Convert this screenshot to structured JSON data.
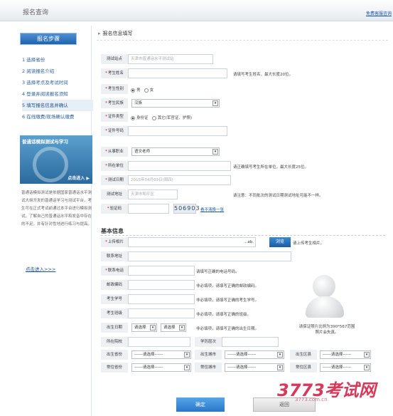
{
  "header": {
    "title": "报名查询",
    "link": "免费客服咨询"
  },
  "sidebar": {
    "steps_title": "报名步骤",
    "steps": [
      "1 选择省份",
      "2 阅读报名介绍",
      "3 选择考点及考试时间",
      "4 登录并阅读报名须知",
      "5 填写报名信息并确认",
      "6 在线缴费/现场确认缴费"
    ],
    "promo_title": "普通话模拟测试与学习",
    "promo_enter": "点击进入 ▶",
    "description": "普通话模拟测试是依据国家普通话水平测试大纲开发的普通话学习与测试平台，考生可在正式考试前通过本平台进行模拟测试，了解自己的普通话水平和发音中存在的不足，并有针对性地进行练习与提高。",
    "desc_link": "点击进入>>>"
  },
  "form": {
    "section_title": "报名信息填写",
    "fields": {
      "test_site": {
        "label": "测试站点",
        "value": "天津市普通话水平测试站"
      },
      "name": {
        "label": "考生姓名",
        "hint": "请填写考生姓名，最大长度20位。"
      },
      "gender": {
        "label": "考生性别",
        "opt1": "男",
        "opt2": "女"
      },
      "ethnicity": {
        "label": "考生民族",
        "value": "汉族"
      },
      "id_type": {
        "label": "证件类型",
        "opt1": "身份证",
        "opt2": "其它(军官证、护照)"
      },
      "id_number": {
        "label": "证件号码"
      },
      "occupation": {
        "label": "从事职业",
        "value": "语文老师"
      },
      "workplace": {
        "label": "所在单位",
        "hint": "请正确填写考生所在单位，最大长度25位。"
      },
      "test_date": {
        "label": "测试日期",
        "value": "2015年04月09日(周四)"
      },
      "test_address": {
        "label": "测试地址",
        "value": "天津市和平区",
        "hint": "请注意：不同批次的测试日期测试地址可能不一样。"
      },
      "captcha": {
        "label": "验证码",
        "code": "506903",
        "refresh": "看不清换一张"
      }
    }
  },
  "basic": {
    "title": "基本信息",
    "upload_label": "上传相片",
    "upload_value": "...ab.",
    "upload_button": "浏览",
    "upload_hint": "请上传考生相片。",
    "contact_address": "联系地址",
    "phone": {
      "label": "联系电话",
      "hint": "请填写正确的电话号码。"
    },
    "postcode": {
      "label": "邮政编码",
      "hint": "非必填项，请填写正确的邮政编码。"
    },
    "student_no": {
      "label": "考生学号",
      "hint": "非必填项，请填写正确的考生学号。"
    },
    "class": {
      "label": "考生班级",
      "hint": "非必填项，请填写正确的班级。"
    },
    "birth": {
      "label": "出生日期",
      "year": "请选择",
      "month": "请选择",
      "hint": "非必填项，请填写正确的出生日期。"
    },
    "school": {
      "label": "所在院校",
      "level_label": "学历层次"
    },
    "province_birth": {
      "label": "出生省份",
      "value": "------请选择------"
    },
    "city_birth": {
      "label": "出生城市",
      "value": "------请选择------"
    },
    "district_birth": {
      "label": "出生区县",
      "value": "------请选择------"
    },
    "province_home": {
      "label": "常住省份",
      "value": "------请选择------"
    },
    "city_home": {
      "label": "常住城市",
      "value": "------请选择------"
    },
    "district_home": {
      "label": "常住区县",
      "value": "------请选择------"
    },
    "photo_caption": "请保证照片比例为390*567范围照片会失真。"
  },
  "actions": {
    "ok": "确定",
    "back": "返回"
  },
  "watermark": {
    "main": "3773考试网",
    "sub": "3773.com.cn"
  }
}
